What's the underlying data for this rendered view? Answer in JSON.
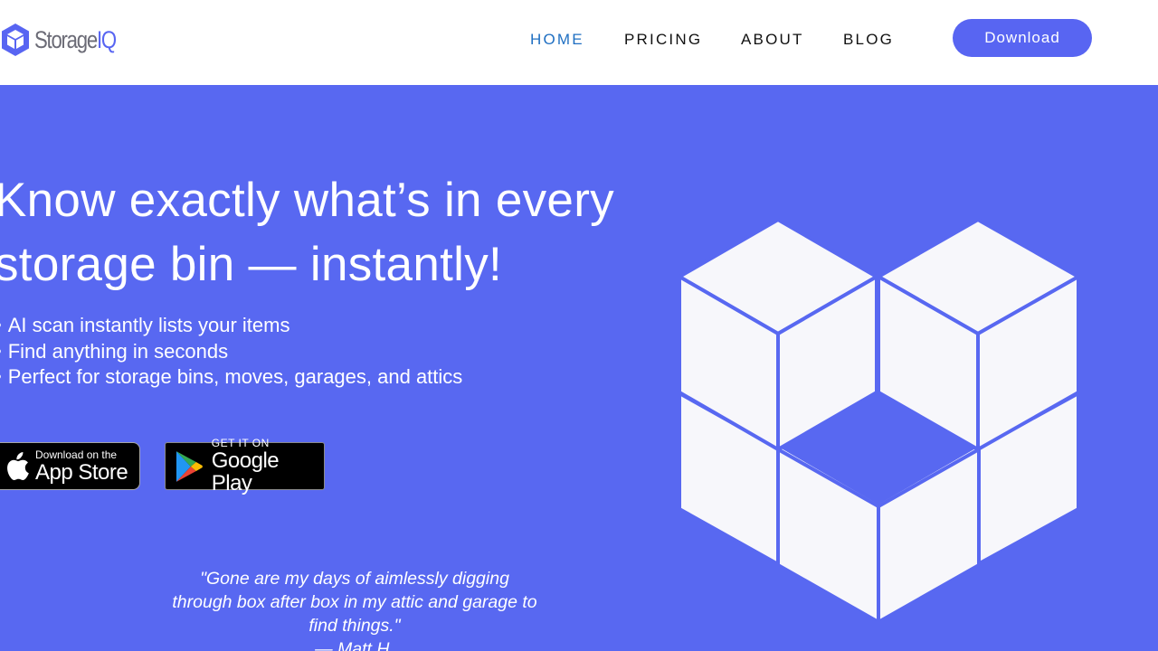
{
  "brand": {
    "name_plain": "Storage",
    "name_accent": "IQ",
    "accent_color": "#5865f2",
    "logo_icon": "isometric-cube-icon"
  },
  "nav": {
    "items": [
      {
        "label": "HOME",
        "active": true
      },
      {
        "label": "PRICING",
        "active": false
      },
      {
        "label": "ABOUT",
        "active": false
      },
      {
        "label": "BLOG",
        "active": false
      }
    ],
    "active_color": "#1f6fc2",
    "download_label": "Download"
  },
  "hero": {
    "background": "#5868f1",
    "title_line1": "Know exactly what’s in every",
    "title_line2": "storage bin — instantly!",
    "bullets": [
      "AI scan instantly lists your items",
      "Find anything in seconds",
      "Perfect for storage bins, moves, garages, and attics"
    ],
    "app_store": {
      "small": "Download on the",
      "big": "App Store",
      "icon": "apple-icon"
    },
    "google_play": {
      "small": "GET IT ON",
      "big": "Google Play",
      "icon": "google-play-icon"
    },
    "quote": "\"Gone are my days of aimlessly digging through box after box in my attic and garage to find things.\"",
    "quote_author": "— Matt H.",
    "illustration": "stacked-cubes-icon"
  }
}
